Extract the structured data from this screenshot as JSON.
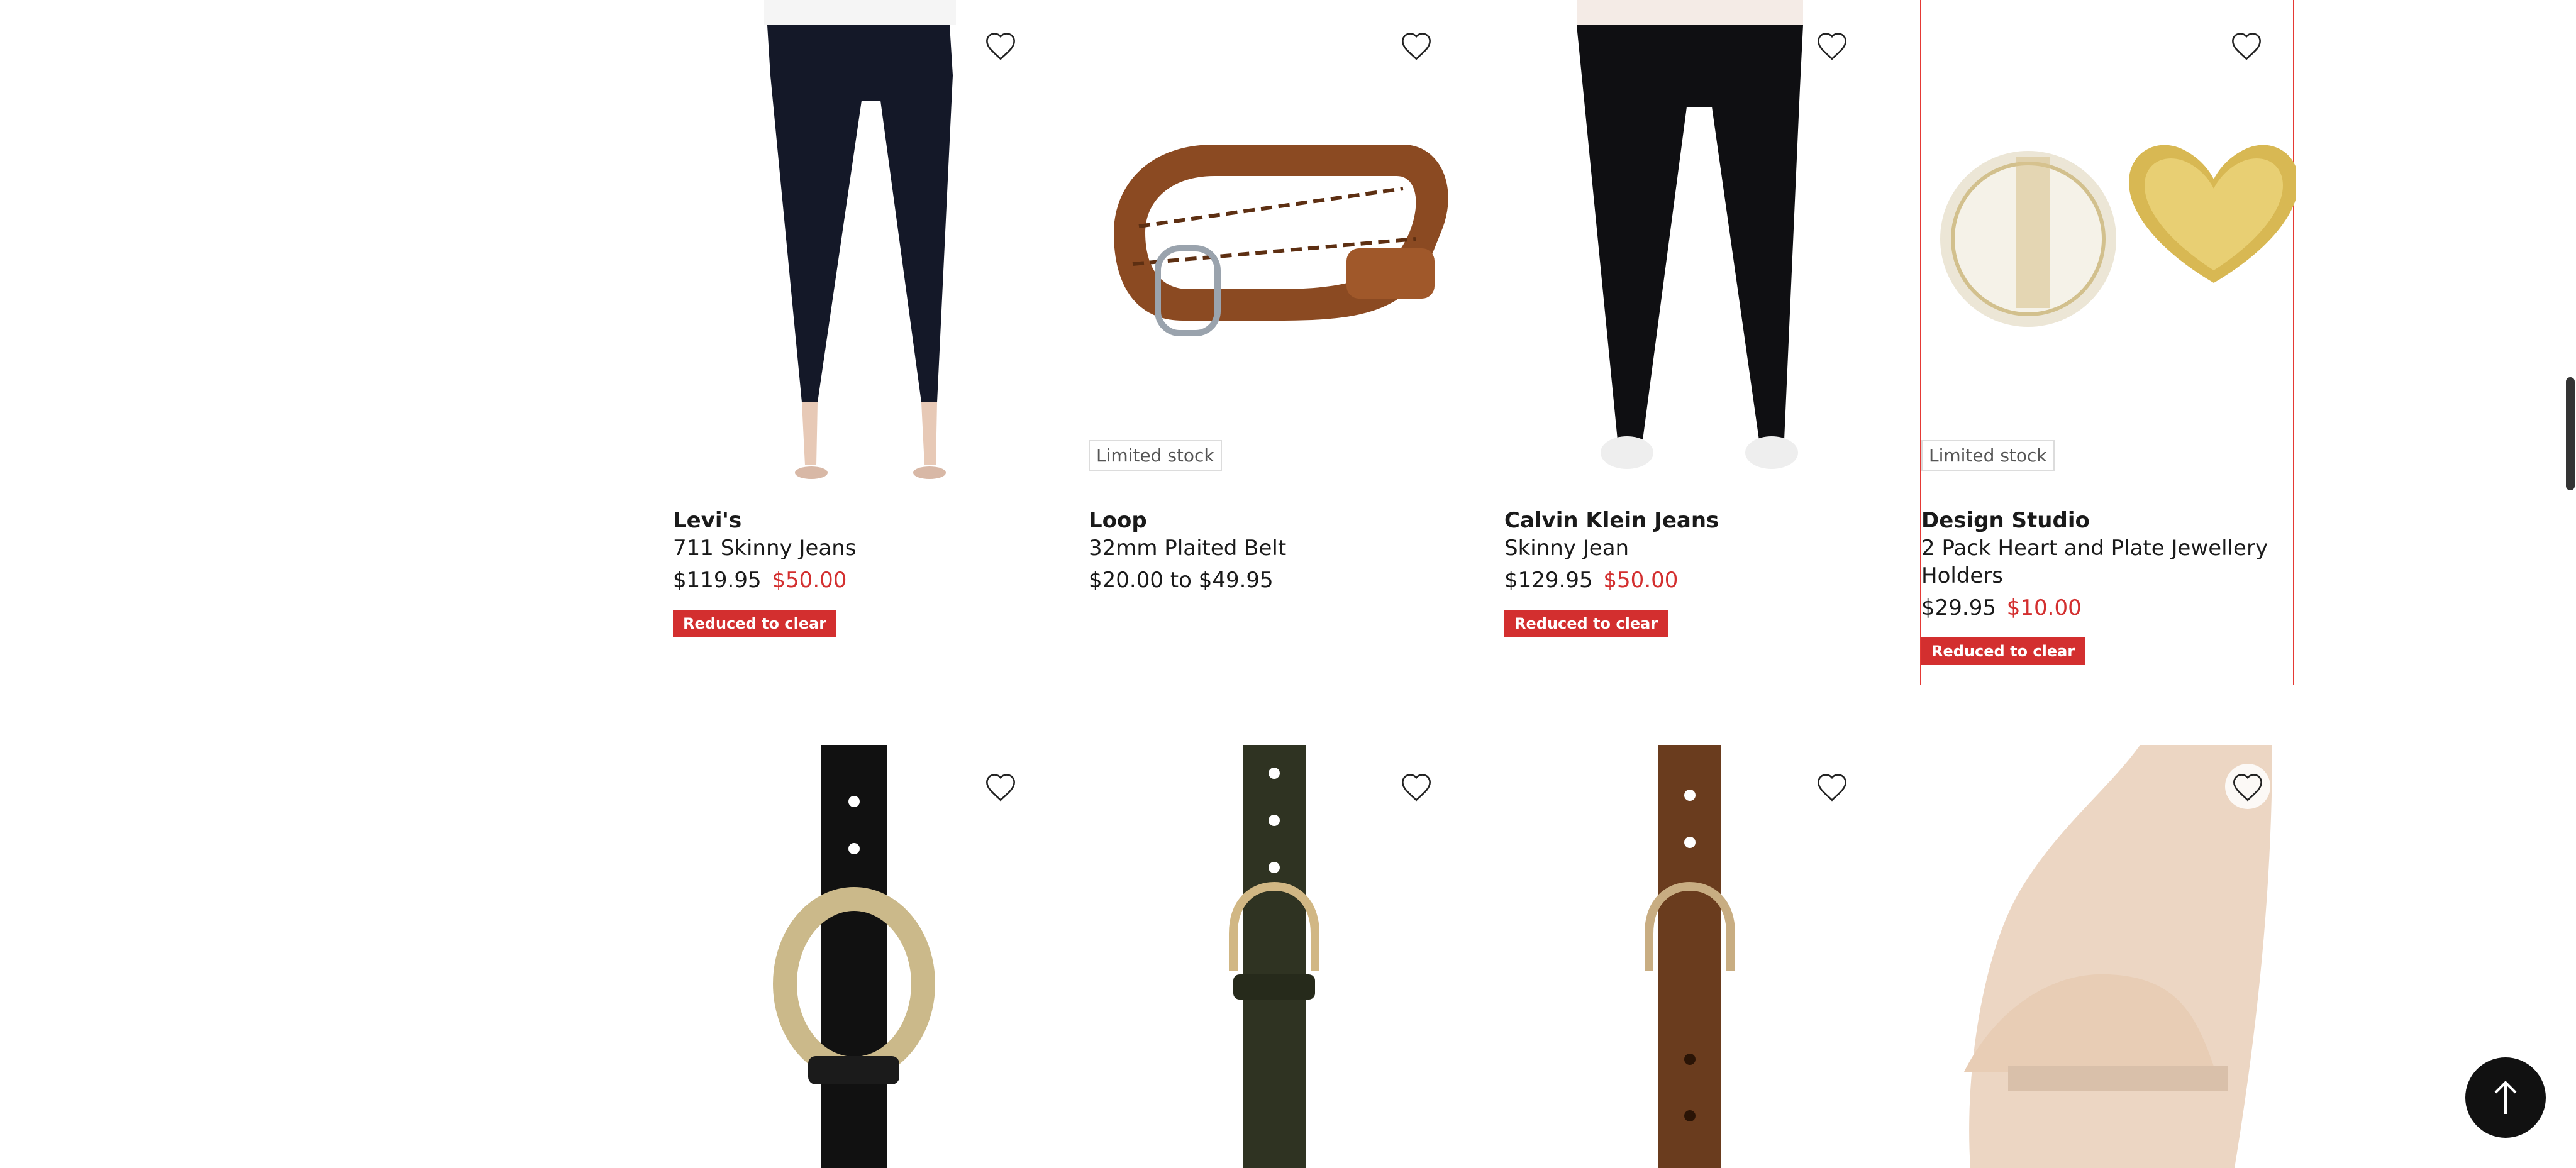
{
  "colors": {
    "sale": "#d32f2f",
    "badge_border": "#dcdcdc",
    "selected_border": "#e53935"
  },
  "products_row1": [
    {
      "brand": "Levi's",
      "name": "711 Skinny Jeans",
      "was_price": "$119.95",
      "now_price": "$50.00",
      "badge": "Reduced to clear",
      "stock": ""
    },
    {
      "brand": "Loop",
      "name": "32mm Plaited Belt",
      "price_range": "$20.00 to $49.95",
      "stock": "Limited stock"
    },
    {
      "brand": "Calvin Klein Jeans",
      "name": "Skinny Jean",
      "was_price": "$129.95",
      "now_price": "$50.00",
      "badge": "Reduced to clear",
      "stock": ""
    },
    {
      "brand": "Design Studio",
      "name": "2 Pack Heart and Plate Jewellery Holders",
      "was_price": "$29.95",
      "now_price": "$10.00",
      "badge": "Reduced to clear",
      "stock": "Limited stock"
    }
  ],
  "icons": {
    "wishlist": "heart-outline-icon",
    "scroll_top": "arrow-up-icon"
  }
}
